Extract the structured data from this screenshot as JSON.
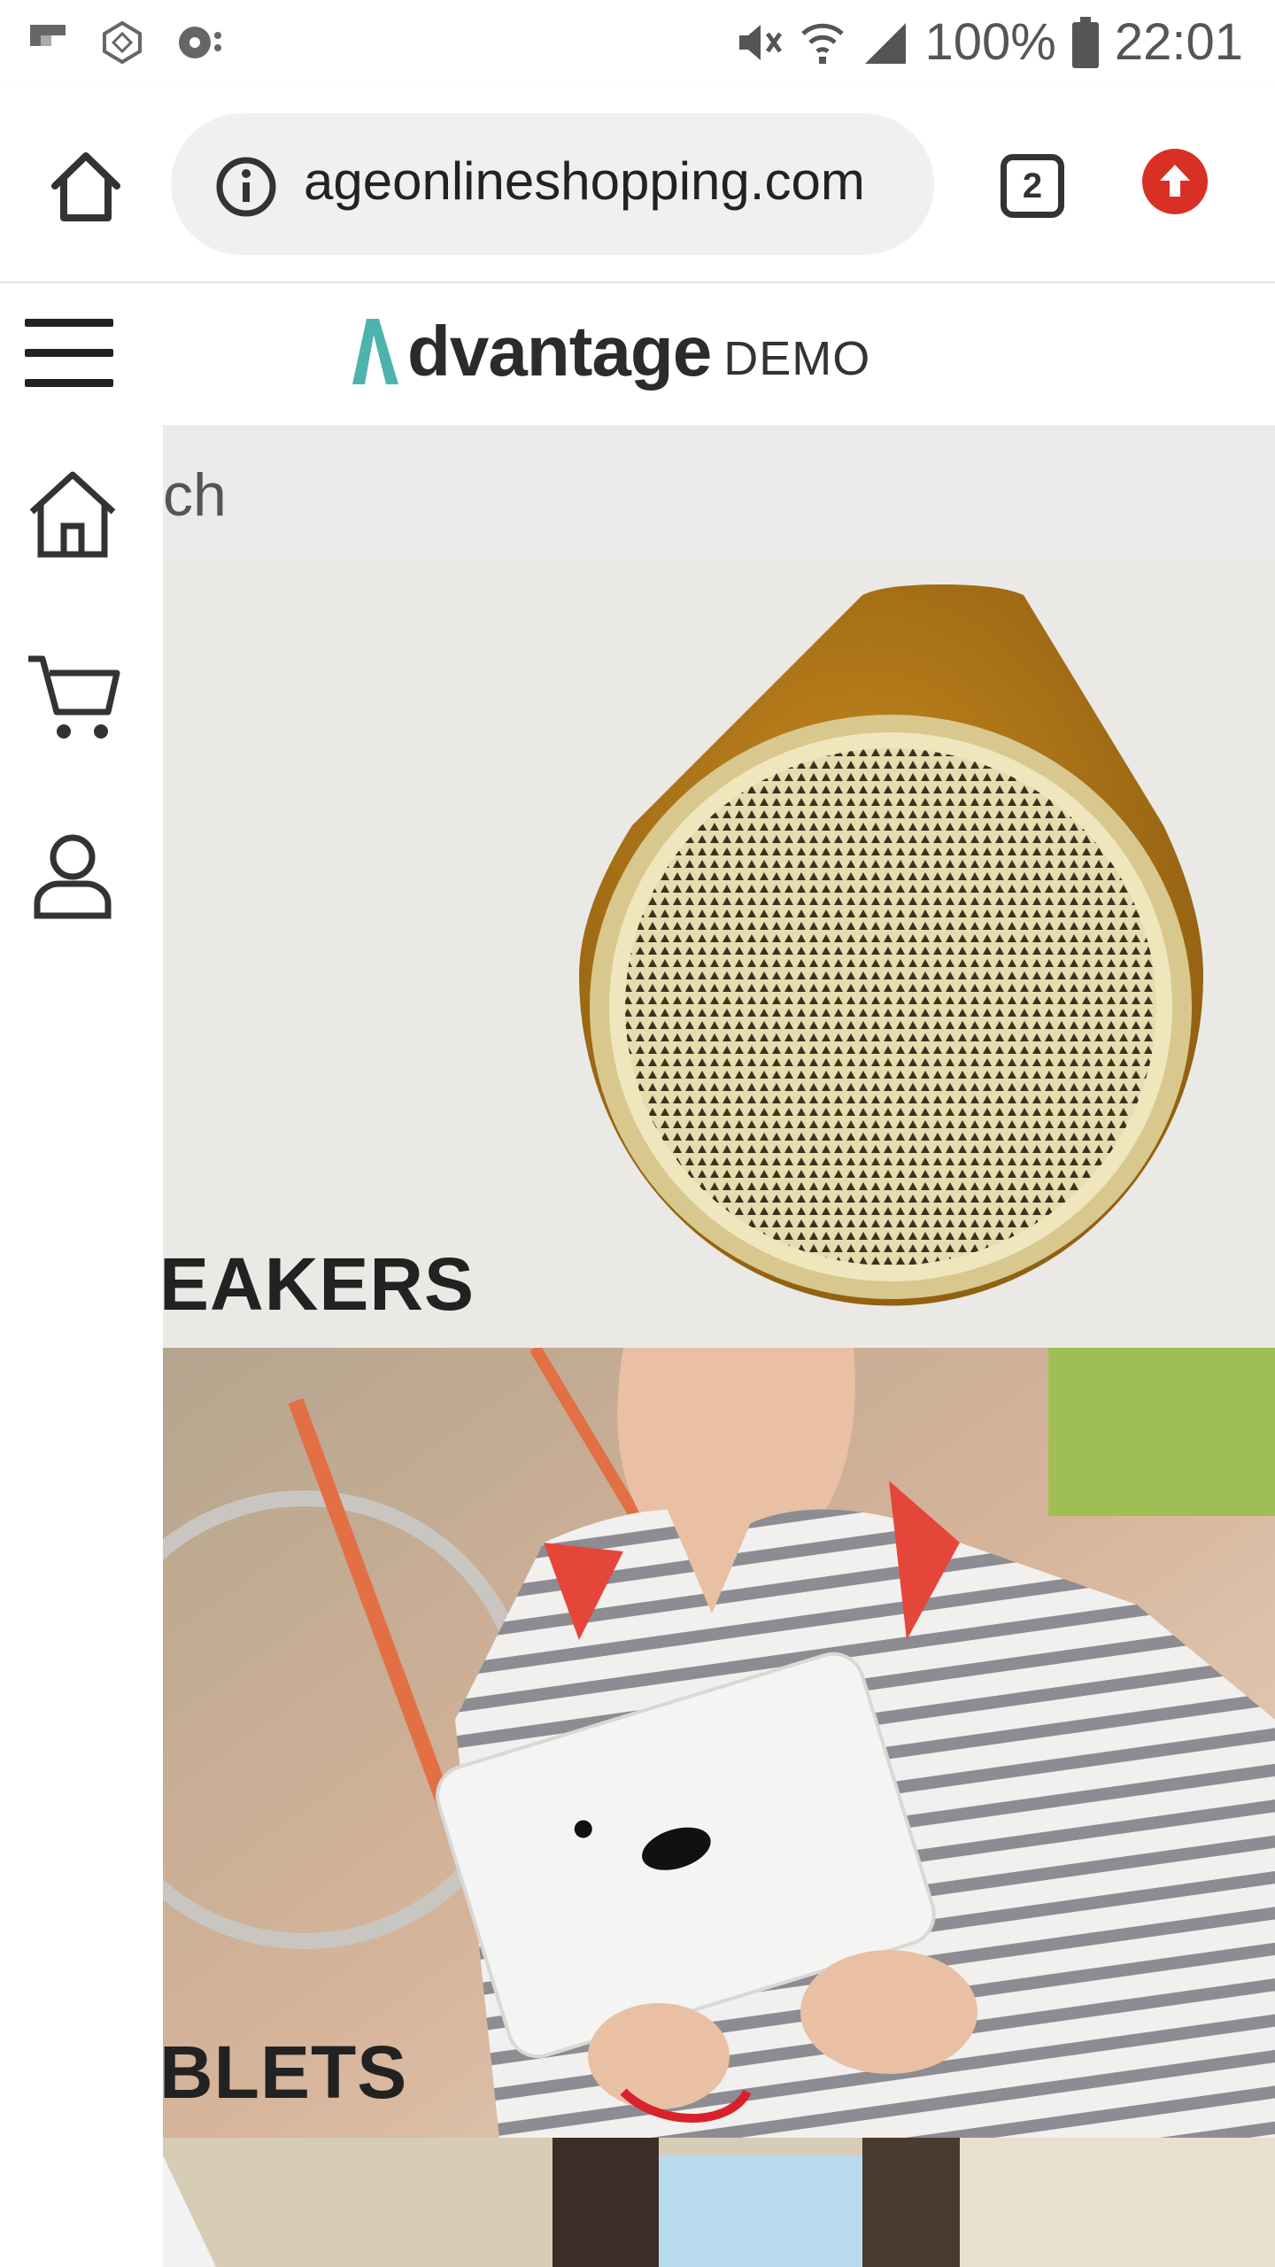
{
  "status_bar": {
    "battery": "100%",
    "time": "22:01",
    "left_icons": [
      "flipboard-icon",
      "app-icon",
      "podcast-icon"
    ],
    "right_icons": [
      "mute-icon",
      "wifi-icon",
      "signal-icon",
      "battery-icon"
    ]
  },
  "browser": {
    "url": "ageonlineshopping.com",
    "tab_count": "2",
    "icons": [
      "home-icon",
      "info-icon",
      "tabs-icon",
      "update-icon"
    ]
  },
  "app": {
    "logo_text": "dvantage",
    "logo_suffix": "DEMO",
    "search_partial": "ch",
    "sidebar_icons": [
      "home-icon",
      "cart-icon",
      "user-icon"
    ],
    "categories": [
      {
        "label": "EAKERS"
      },
      {
        "label": "BLETS"
      }
    ]
  },
  "colors": {
    "accent_teal": "#4fb3ad",
    "update_red": "#d93025"
  }
}
